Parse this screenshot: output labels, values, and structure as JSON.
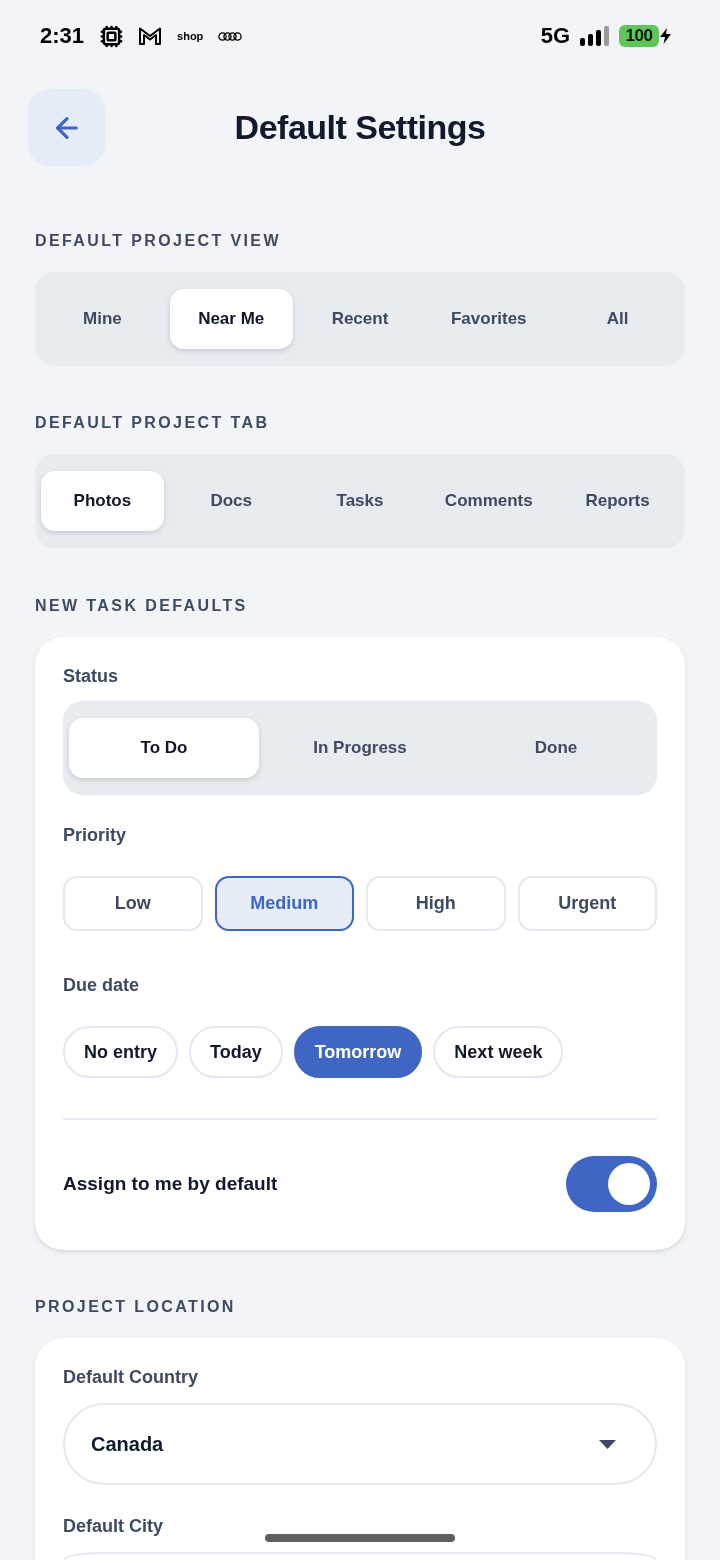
{
  "status_bar": {
    "time": "2:31",
    "shop_label": "shop",
    "network": "5G",
    "battery": "100"
  },
  "header": {
    "title": "Default Settings"
  },
  "project_view": {
    "heading": "DEFAULT PROJECT VIEW",
    "options": [
      {
        "label": "Mine",
        "selected": false
      },
      {
        "label": "Near Me",
        "selected": true
      },
      {
        "label": "Recent",
        "selected": false
      },
      {
        "label": "Favorites",
        "selected": false
      },
      {
        "label": "All",
        "selected": false
      }
    ]
  },
  "project_tab": {
    "heading": "DEFAULT PROJECT TAB",
    "options": [
      {
        "label": "Photos",
        "selected": true
      },
      {
        "label": "Docs",
        "selected": false
      },
      {
        "label": "Tasks",
        "selected": false
      },
      {
        "label": "Comments",
        "selected": false
      },
      {
        "label": "Reports",
        "selected": false
      }
    ]
  },
  "task_defaults": {
    "heading": "NEW TASK DEFAULTS",
    "status": {
      "label": "Status",
      "options": [
        {
          "label": "To Do",
          "selected": true
        },
        {
          "label": "In Progress",
          "selected": false
        },
        {
          "label": "Done",
          "selected": false
        }
      ]
    },
    "priority": {
      "label": "Priority",
      "options": [
        {
          "label": "Low",
          "selected": false
        },
        {
          "label": "Medium",
          "selected": true
        },
        {
          "label": "High",
          "selected": false
        },
        {
          "label": "Urgent",
          "selected": false
        }
      ]
    },
    "due_date": {
      "label": "Due date",
      "options": [
        {
          "label": "No entry",
          "selected": false
        },
        {
          "label": "Today",
          "selected": false
        },
        {
          "label": "Tomorrow",
          "selected": true
        },
        {
          "label": "Next week",
          "selected": false
        }
      ]
    },
    "assign_to_me": {
      "label": "Assign to me by default",
      "on": true
    }
  },
  "project_location": {
    "heading": "PROJECT LOCATION",
    "country": {
      "label": "Default Country",
      "value": "Canada"
    },
    "city": {
      "label": "Default City"
    }
  }
}
